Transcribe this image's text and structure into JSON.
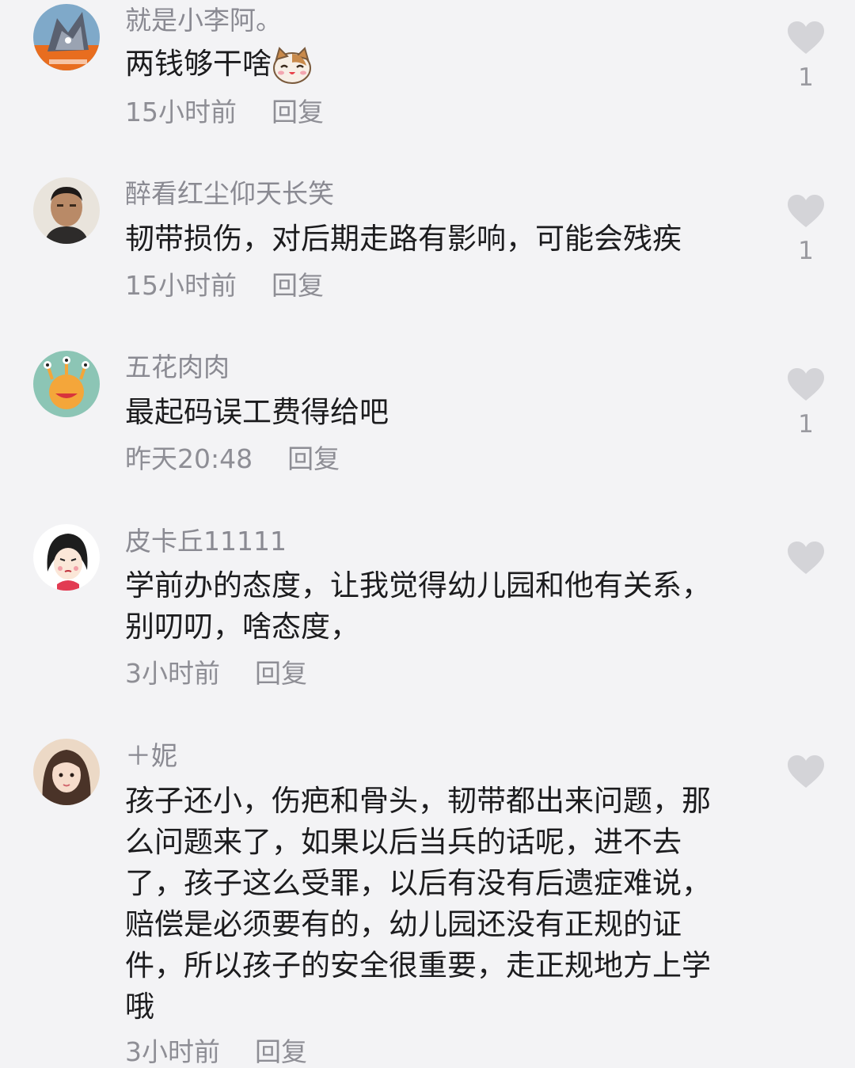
{
  "comments": [
    {
      "username": "就是小李阿。",
      "lines": [
        "两钱够干啥"
      ],
      "has_cat_emoji": true,
      "time": "15小时前",
      "reply": "回复",
      "likes": "1"
    },
    {
      "username": "醉看红尘仰天长笑",
      "lines": [
        "韧带损伤，对后期走路有影响，可能会残疾"
      ],
      "time": "15小时前",
      "reply": "回复",
      "likes": "1"
    },
    {
      "username": "五花肉肉",
      "lines": [
        "最起码误工费得给吧"
      ],
      "time": "昨天20:48",
      "reply": "回复",
      "likes": "1"
    },
    {
      "username": "皮卡丘11111",
      "lines": [
        "学前办的态度，让我觉得幼儿园和他有关系，",
        "别叨叨，啥态度，"
      ],
      "time": "3小时前",
      "reply": "回复",
      "likes": ""
    },
    {
      "username": "＋妮",
      "lines": [
        "孩子还小，伤疤和骨头，韧带都出来问题，那",
        "么问题来了，如果以后当兵的话呢，进不去",
        "了，孩子这么受罪，以后有没有后遗症难说，",
        "赔偿是必须要有的，幼儿园还没有正规的证",
        "件，所以孩子的安全很重要，走正规地方上学",
        "哦"
      ],
      "time": "3小时前",
      "reply": "回复",
      "likes": ""
    }
  ],
  "colors": {
    "background": "#f3f3f5",
    "username": "#8a8a92",
    "text": "#1c1c1e",
    "meta": "#8e8e95",
    "heart": "#d4d4d8"
  },
  "icons": {
    "like": "heart-icon",
    "emoji": "cat-face-emoji"
  }
}
